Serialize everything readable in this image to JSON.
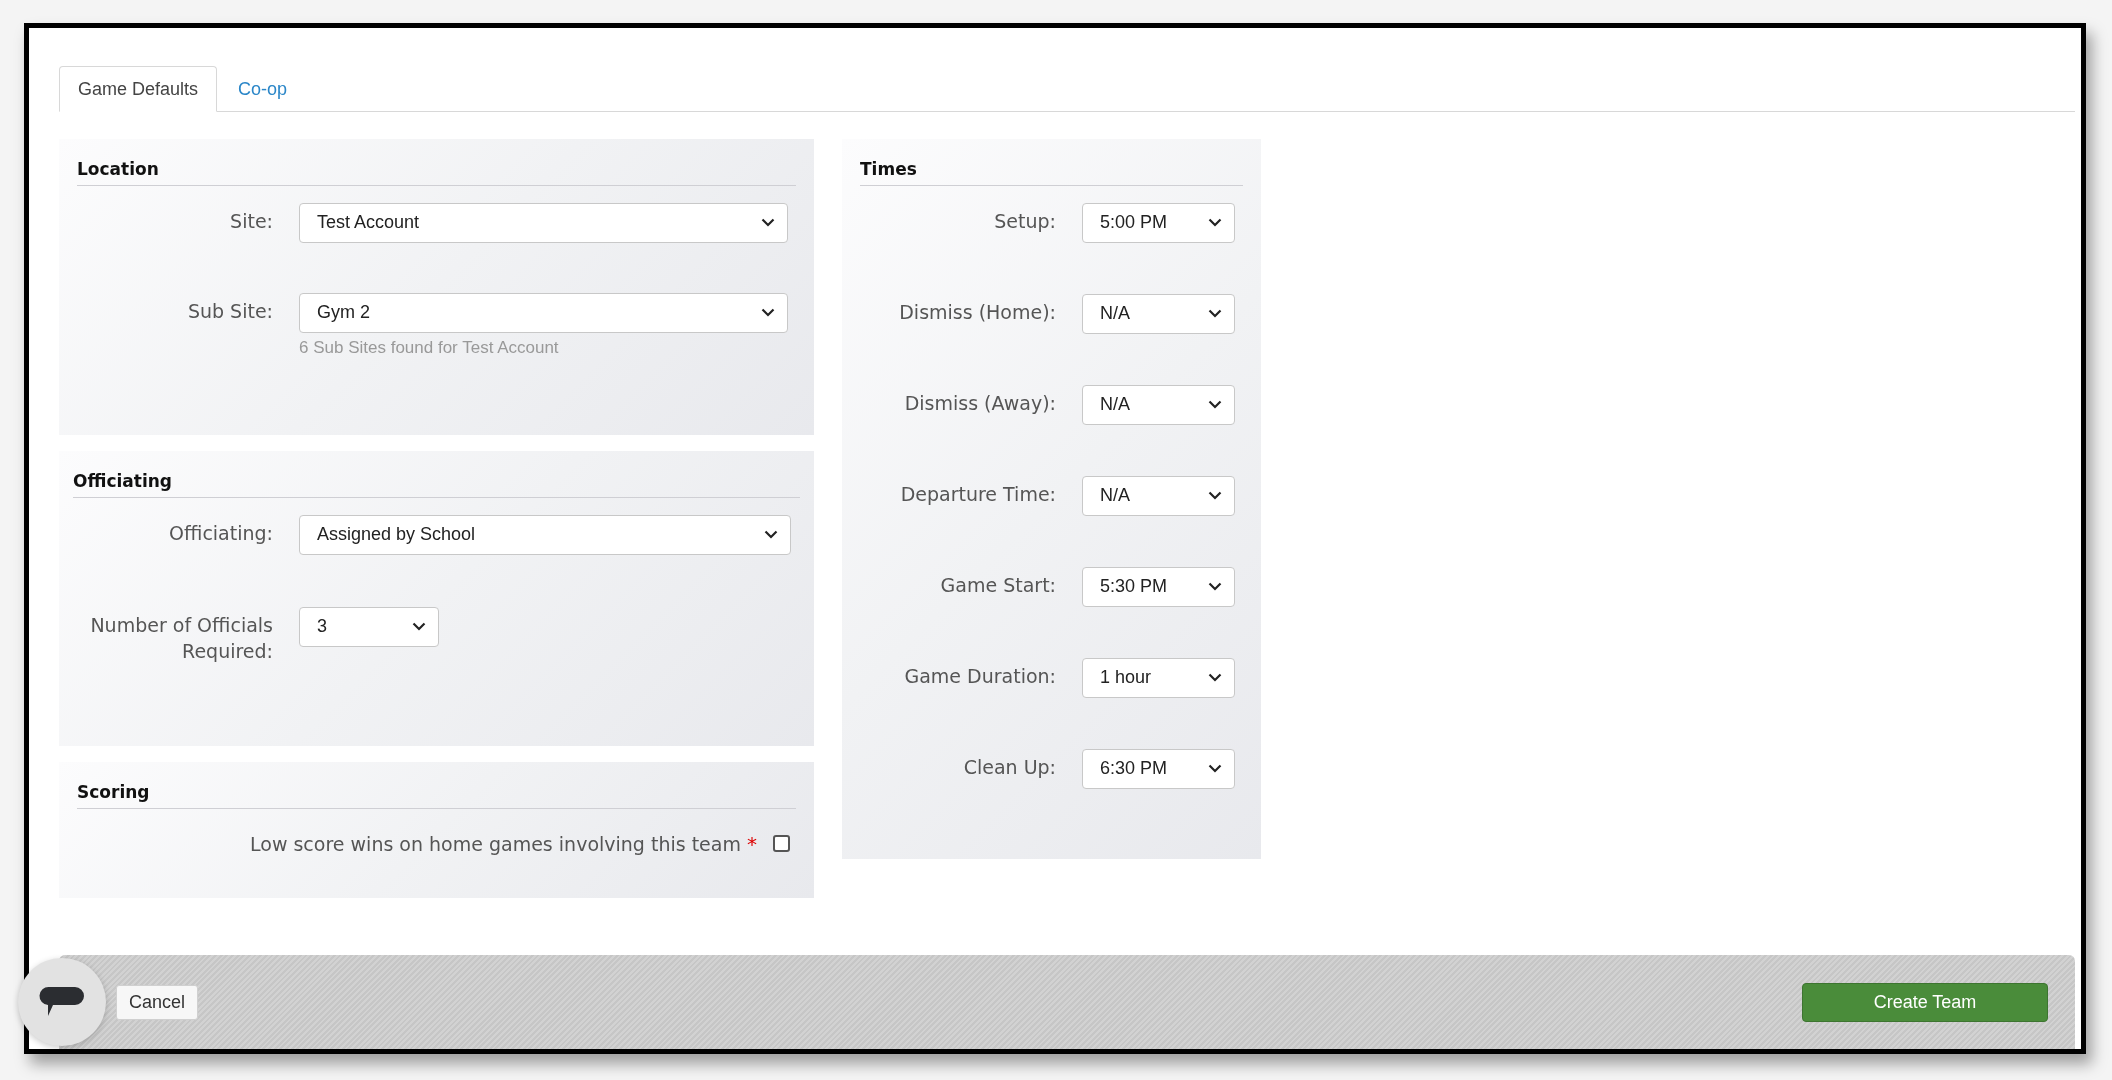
{
  "tabs": [
    {
      "label": "Game Defaults",
      "selected": true
    },
    {
      "label": "Co-op",
      "selected": false
    }
  ],
  "location": {
    "title": "Location",
    "fields": [
      {
        "label": "Site:",
        "value": "Test Account"
      },
      {
        "label": "Sub Site:",
        "value": "Gym 2",
        "hint": "6 Sub Sites found for Test Account"
      }
    ]
  },
  "officiating": {
    "title": "Officiating",
    "fields": [
      {
        "label": "Officiating:",
        "value": "Assigned by School"
      },
      {
        "label": "Number of Officials Required:",
        "value": "3"
      }
    ]
  },
  "scoring": {
    "title": "Scoring",
    "option": {
      "label": "Low score wins on home games involving this team",
      "required_mark": "*",
      "checked": false
    }
  },
  "times": {
    "title": "Times",
    "fields": [
      {
        "label": "Setup:",
        "value": "5:00 PM"
      },
      {
        "label": "Dismiss (Home):",
        "value": "N/A"
      },
      {
        "label": "Dismiss (Away):",
        "value": "N/A"
      },
      {
        "label": "Departure Time:",
        "value": "N/A"
      },
      {
        "label": "Game Start:",
        "value": "5:30 PM"
      },
      {
        "label": "Game Duration:",
        "value": "1 hour"
      },
      {
        "label": "Clean Up:",
        "value": "6:30 PM"
      }
    ]
  },
  "footer": {
    "cancel": "Cancel",
    "submit": "Create Team"
  }
}
